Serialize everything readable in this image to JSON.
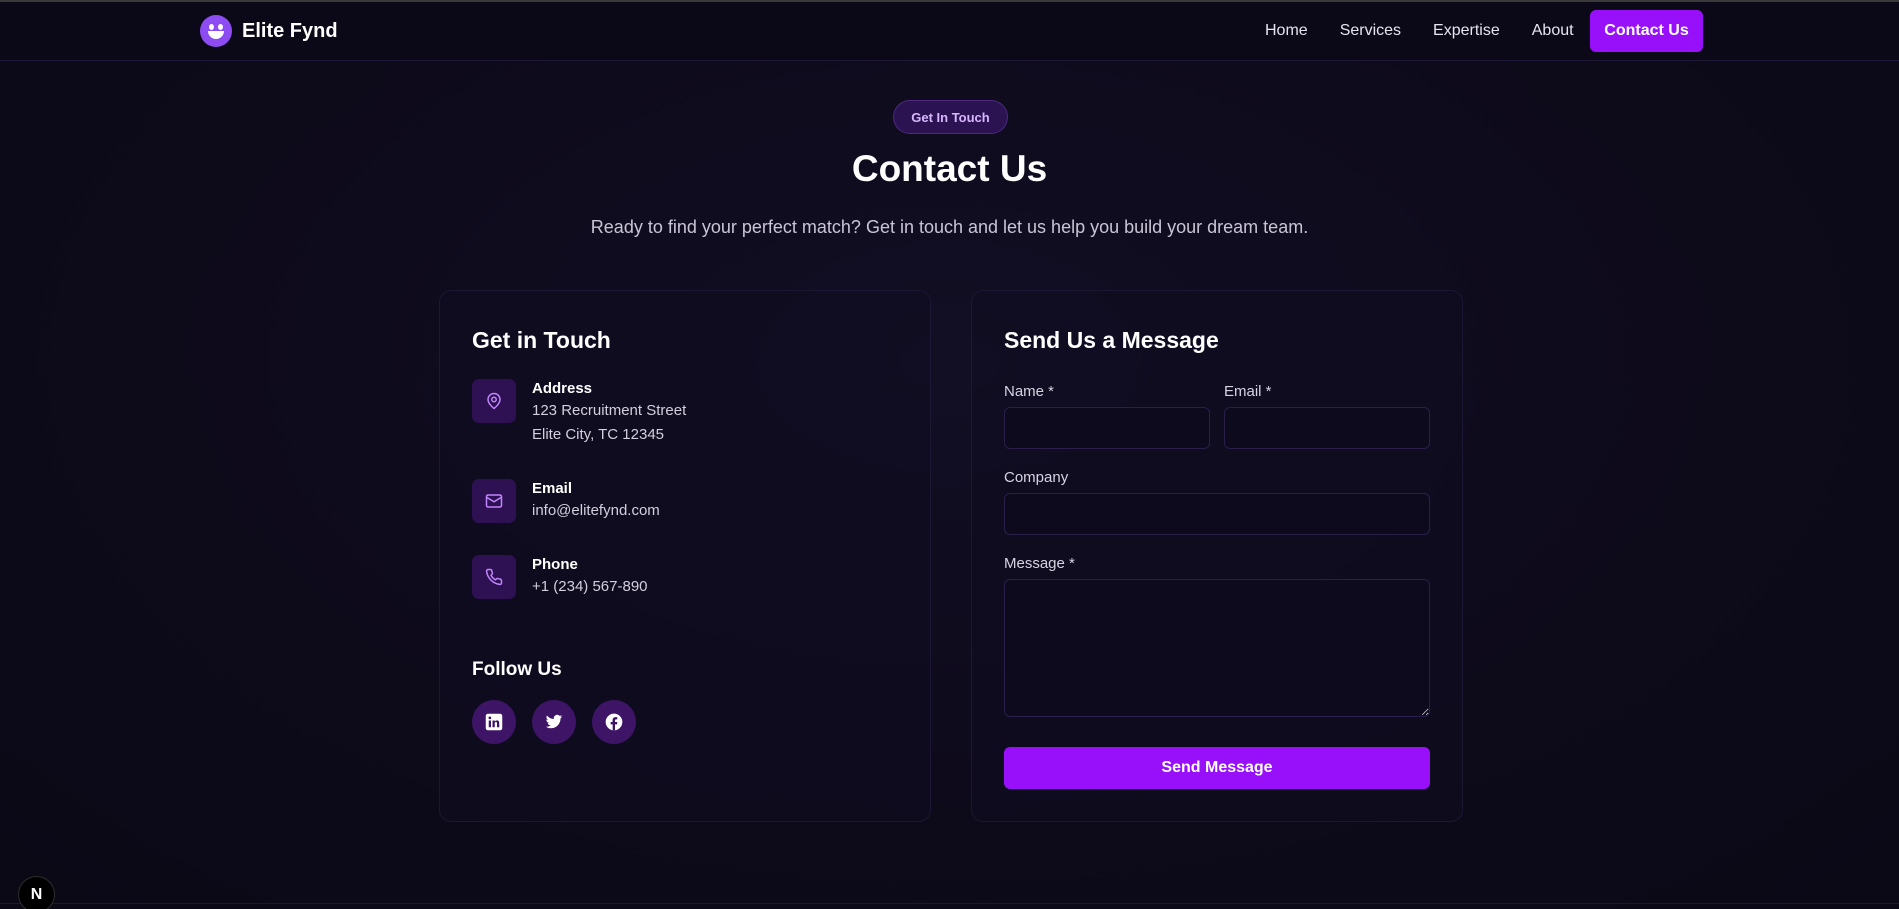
{
  "nav": {
    "brand": "Elite Fynd",
    "links": [
      "Home",
      "Services",
      "Expertise",
      "About"
    ],
    "cta": "Contact Us"
  },
  "hero": {
    "pill": "Get In Touch",
    "title": "Contact Us",
    "subtitle": "Ready to find your perfect match? Get in touch and let us help you build your dream team."
  },
  "info_card": {
    "title": "Get in Touch",
    "address": {
      "label": "Address",
      "line1": "123 Recruitment Street",
      "line2": "Elite City, TC 12345",
      "icon": "map-pin-icon"
    },
    "email": {
      "label": "Email",
      "value": "info@elitefynd.com",
      "icon": "mail-icon"
    },
    "phone": {
      "label": "Phone",
      "value": "+1 (234) 567-890",
      "icon": "phone-icon"
    },
    "follow_title": "Follow Us",
    "socials": [
      "linkedin-icon",
      "twitter-icon",
      "facebook-icon"
    ]
  },
  "form": {
    "title": "Send Us a Message",
    "name_label": "Name *",
    "email_label": "Email *",
    "company_label": "Company",
    "message_label": "Message *",
    "name_value": "",
    "email_value": "",
    "company_value": "",
    "message_value": "",
    "submit": "Send Message"
  },
  "dev_badge": "N",
  "colors": {
    "accent": "#9810fa",
    "background": "#0e0b1c",
    "icon_tile": "#2e1152",
    "icon_stroke": "#c084fc"
  }
}
